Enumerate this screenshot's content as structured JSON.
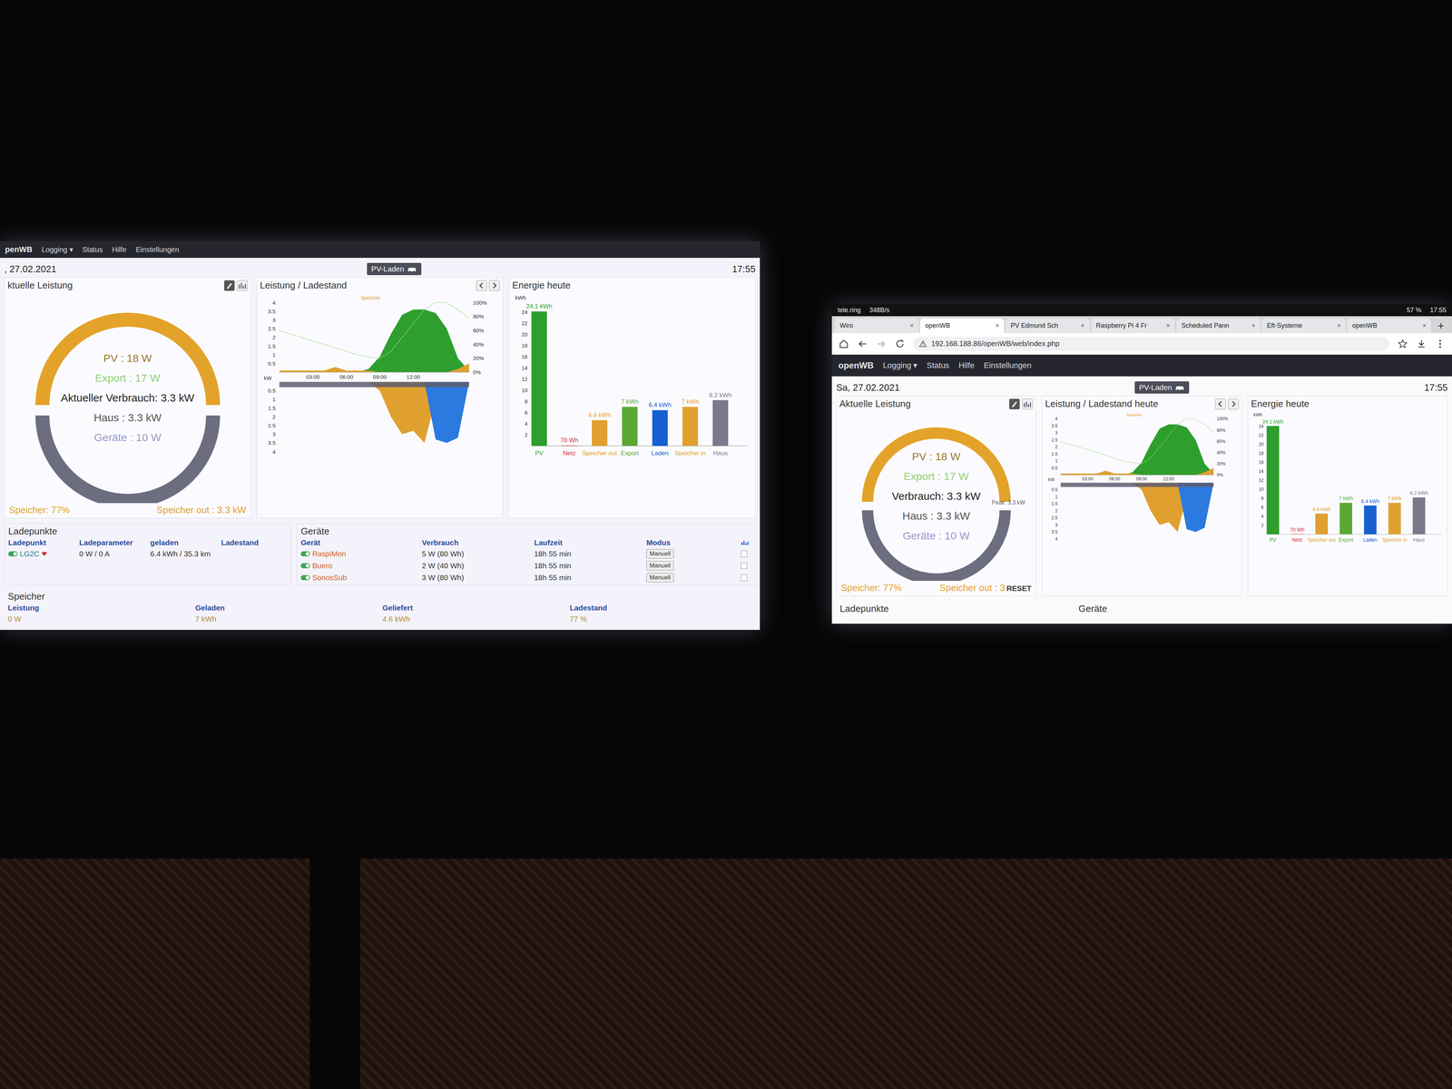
{
  "screens": [
    {
      "device": "monitor",
      "navbar": {
        "brand": "penWB",
        "items": [
          "Logging ▾",
          "Status",
          "Hilfe",
          "Einstellungen"
        ]
      },
      "date": ", 27.02.2021",
      "mode_button": "PV-Laden",
      "time": "17:55",
      "power": {
        "title": "ktuelle Leistung",
        "pv": "PV : 18 W",
        "export": "Export : 17 W",
        "consumption": "Aktueller Verbrauch: 3.3 kW",
        "house": "Haus : 3.3 kW",
        "devices": "Geräte : 10 W",
        "storage": "Speicher: 77%",
        "storage_out": "Speicher out : 3.3 kW"
      },
      "chart": {
        "title": "Leistung / Ladestand",
        "legend": "Speicher",
        "unit": "kW"
      },
      "energy": {
        "title": "Energie heute",
        "unit": "kWh"
      },
      "ladepunkte": {
        "title": "Ladepunkte",
        "columns": [
          "Ladepunkt",
          "Ladeparameter",
          "geladen",
          "Ladestand"
        ],
        "rows": [
          {
            "name": "LG2C",
            "on": true,
            "params": "0 W / 0 A",
            "charged": "6.4 kWh / 35.3 km"
          }
        ]
      },
      "geraete": {
        "title": "Geräte",
        "columns": [
          "Gerät",
          "Verbrauch",
          "Laufzeit",
          "Modus"
        ],
        "rows": [
          {
            "name": "RaspiMon",
            "on": true,
            "usage": "5 W (80 Wh)",
            "runtime": "18h 55 min",
            "mode": "Manuell",
            "checked": false
          },
          {
            "name": "Buero",
            "on": true,
            "usage": "2 W (40 Wh)",
            "runtime": "18h 55 min",
            "mode": "Manuell",
            "checked": false
          },
          {
            "name": "SonosSub",
            "on": true,
            "usage": "3 W (80 Wh)",
            "runtime": "18h 55 min",
            "mode": "Manuell",
            "checked": false
          }
        ]
      },
      "speicher": {
        "title": "Speicher",
        "columns": [
          "Leistung",
          "Geladen",
          "Geliefert",
          "Ladestand"
        ],
        "values": [
          "0 W",
          "7 kWh",
          "4.6 kWh",
          "77 %"
        ]
      }
    },
    {
      "device": "tablet",
      "browser": {
        "status": {
          "carrier": "tele.ring",
          "rate": "348B/s",
          "battery": "57 %",
          "time": "17:55"
        },
        "tabs": [
          {
            "label": "Wiro",
            "selected": false
          },
          {
            "label": "openWB",
            "selected": true
          },
          {
            "label": "PV Edmund Sch",
            "selected": false
          },
          {
            "label": "Raspberry Pi 4 Fr",
            "selected": false
          },
          {
            "label": "Scheduled Pann",
            "selected": false
          },
          {
            "label": "Eft-Systeme",
            "selected": false
          },
          {
            "label": "openWB",
            "selected": false
          }
        ],
        "close": "×",
        "new_tab": "+",
        "url": "192.168.188.86/openWB/web/index.php"
      },
      "navbar": {
        "brand": "openWB",
        "items": [
          "Logging ▾",
          "Status",
          "Hilfe",
          "Einstellungen"
        ]
      },
      "date": "Sa, 27.02.2021",
      "mode_button": "PV-Laden",
      "time": "17:55",
      "power": {
        "title": "Aktuelle Leistung",
        "pv": "PV : 18 W",
        "export": "Export : 17 W",
        "consumption": "Verbrauch: 3.3 kW",
        "house": "Haus : 3.3 kW",
        "devices": "Geräte : 10 W",
        "storage": "Speicher: 77%",
        "storage_out": "Speicher out : 3",
        "reset": "RESET",
        "peak": "Peak: 3.3 kW"
      },
      "chart": {
        "title": "Leistung / Ladestand heute",
        "legend": "Speicher",
        "unit": "kW"
      },
      "energy": {
        "title": "Energie heute",
        "unit": "kWh"
      },
      "ladepunkte": {
        "title": "Ladepunkte"
      },
      "geraete": {
        "title": "Geräte"
      }
    }
  ],
  "chart_axes": {
    "upper_ticks": [
      "4",
      "3.5",
      "3",
      "2.5",
      "2",
      "1.5",
      "1",
      "0.5"
    ],
    "lower_ticks": [
      "0.5",
      "1",
      "1.5",
      "2",
      "2.5",
      "3",
      "3.5",
      "4"
    ],
    "x_ticks": [
      "03:00",
      "06:00",
      "09:00",
      "12:00"
    ],
    "soc_ticks": [
      "100%",
      "80%",
      "60%",
      "40%",
      "20%",
      "0%"
    ]
  },
  "history": {
    "pv": [
      0,
      0,
      0,
      0,
      0,
      0,
      0,
      0,
      0.2,
      0.9,
      2.2,
      3.3,
      3.6,
      3.6,
      3.4,
      2.5,
      0.8,
      0.1
    ],
    "storage_out": [
      0.1,
      0.1,
      0.1,
      0.1,
      0.1,
      0.3,
      0.1,
      0.1,
      0.1,
      0,
      0,
      0,
      0,
      0,
      0,
      0,
      0.2,
      0.5
    ],
    "house": [
      0.3,
      0.3,
      0.3,
      0.3,
      0.3,
      0.3,
      0.3,
      0.3,
      0.3,
      0.3,
      0.3,
      0.3,
      0.3,
      0.3,
      0.3,
      0.3,
      0.3,
      0.3
    ],
    "storage_in": [
      0,
      0,
      0,
      0,
      0,
      0,
      0,
      0,
      0,
      0.5,
      2.0,
      3.0,
      2.8,
      3.5,
      1.0,
      0,
      0,
      0
    ],
    "charging": [
      0,
      0,
      0,
      0,
      0,
      0,
      0,
      0,
      0,
      0,
      0,
      0,
      0,
      0,
      3.3,
      3.5,
      3.2,
      0
    ],
    "soc": [
      60,
      55,
      50,
      45,
      40,
      35,
      30,
      25,
      22,
      20,
      30,
      50,
      70,
      90,
      100,
      100,
      90,
      77
    ]
  },
  "energy_ticks": [
    "24",
    "22",
    "20",
    "18",
    "16",
    "14",
    "12",
    "10",
    "8",
    "6",
    "4",
    "2"
  ],
  "energy_bars": [
    {
      "label": "PV",
      "value": 24.1,
      "reading": "24.1 kWh",
      "color": "#2e9e2e"
    },
    {
      "label": "Netz",
      "value": 0.07,
      "reading": "70 Wh",
      "color": "#d03030"
    },
    {
      "label": "Speicher out",
      "value": 4.6,
      "reading": "4.6 kWh",
      "color": "#e0a030"
    },
    {
      "label": "Export",
      "value": 7,
      "reading": "7 kWh",
      "color": "#5aa832"
    },
    {
      "label": "Laden",
      "value": 6.4,
      "reading": "6.4 kWh",
      "color": "#1560d0"
    },
    {
      "label": "Speicher in",
      "value": 7,
      "reading": "7 kWh",
      "color": "#e0a030"
    },
    {
      "label": "Haus",
      "value": 8.2,
      "reading": "8.2 kWh",
      "color": "#7a7a8c"
    }
  ]
}
